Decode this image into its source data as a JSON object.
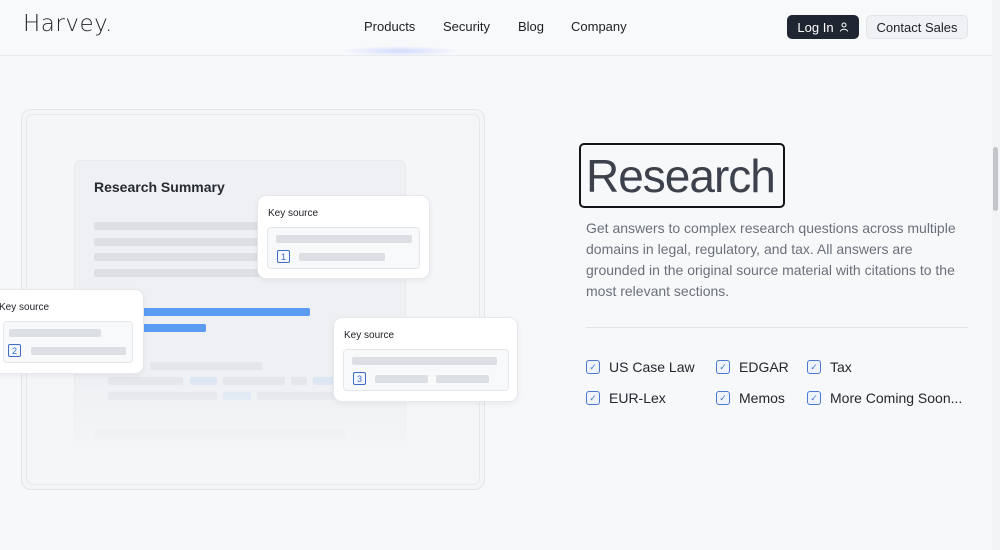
{
  "header": {
    "logo": "Harvey.",
    "nav": [
      {
        "id": "products",
        "label": "Products"
      },
      {
        "id": "security",
        "label": "Security"
      },
      {
        "id": "blog",
        "label": "Blog"
      },
      {
        "id": "company",
        "label": "Company"
      }
    ],
    "login_label": "Log In",
    "contact_label": "Contact Sales"
  },
  "illustration": {
    "doc_title": "Research Summary",
    "cards": [
      {
        "title": "Key source",
        "number": "1"
      },
      {
        "title": "Key source",
        "number": "2"
      },
      {
        "title": "Key source",
        "number": "3"
      }
    ]
  },
  "content": {
    "title": "Research",
    "description": "Get answers to complex research questions across multiple domains in legal, regulatory, and tax. All answers are grounded in the original source material with citations to the most relevant sections.",
    "features": [
      "US Case Law",
      "EDGAR",
      "Tax",
      "EUR-Lex",
      "Memos",
      "More Coming Soon..."
    ]
  },
  "colors": {
    "accent": "#4a78d0",
    "highlight_bar": "#5b9cf2",
    "login_bg": "#1f2632"
  },
  "icons": {
    "login": "user-icon",
    "feature": "checkbox-checked-icon"
  }
}
